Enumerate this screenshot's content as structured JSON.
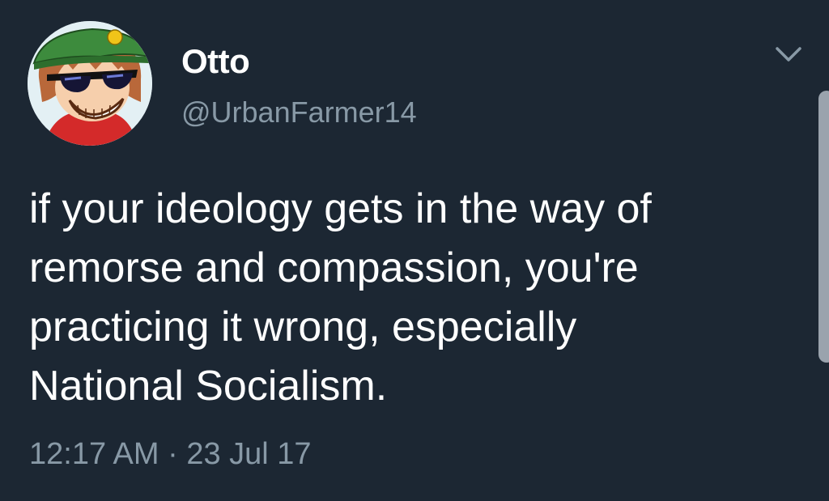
{
  "tweet": {
    "author": {
      "display_name": "Otto",
      "handle": "@UrbanFarmer14",
      "avatar_icon": "cartoon-avatar-icon"
    },
    "text_lines": [
      "if your ideology gets in the way of",
      "remorse and compassion, you're",
      "practicing it wrong, especially",
      "National Socialism."
    ],
    "timestamp": "12:17 AM · 23 Jul 17",
    "menu_icon": "chevron-down-icon"
  },
  "colors": {
    "background": "#1c2733",
    "primary_text": "#ffffff",
    "secondary_text": "#8899a6"
  }
}
